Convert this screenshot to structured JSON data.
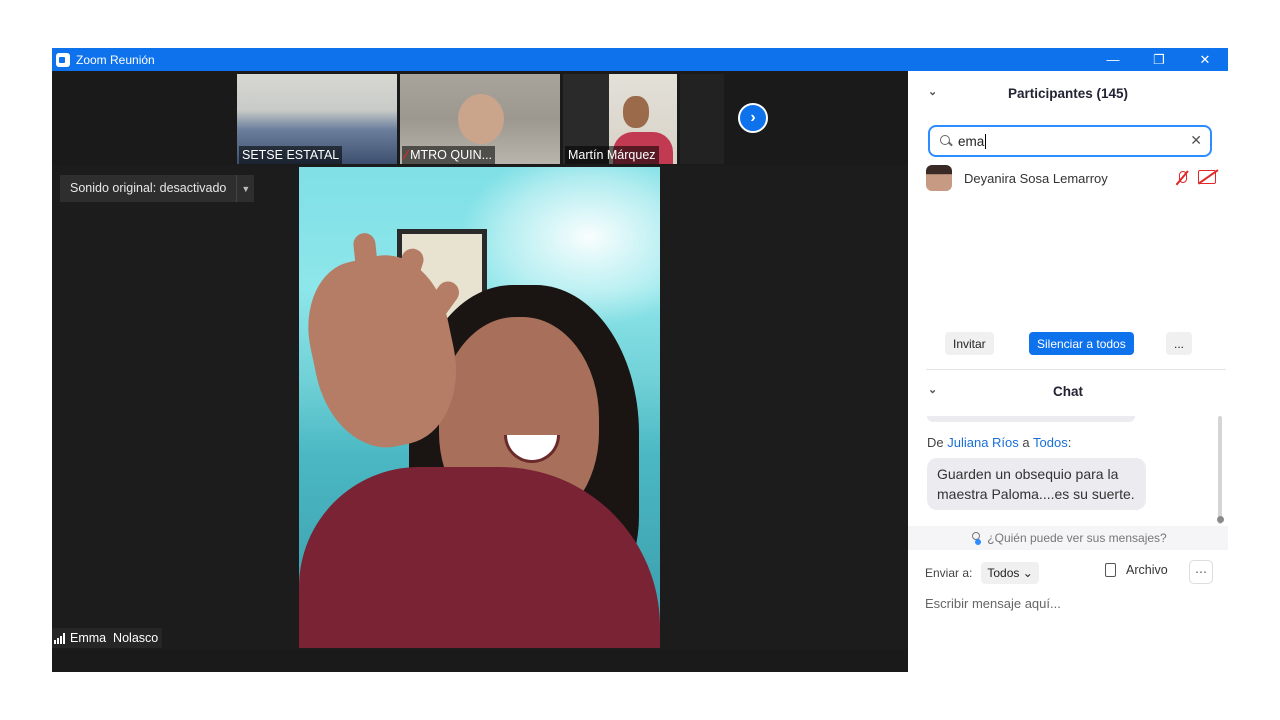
{
  "window": {
    "title": "Zoom Reunión",
    "controls": {
      "minimize": "—",
      "restore": "❐",
      "close": "✕"
    }
  },
  "thumbnails": [
    {
      "name": "SETSE ESTATAL",
      "muted": false
    },
    {
      "name": "MTRO QUIN...",
      "muted": true
    },
    {
      "name": "Martín Márquez",
      "muted": false
    }
  ],
  "video": {
    "sound_toggle_label": "Sonido original: desactivado",
    "speaker_name": "Emma  Nolasco",
    "next_icon": "chevron-right-icon"
  },
  "participants": {
    "header": "Participantes (145)",
    "search_value": "ema",
    "results": [
      {
        "name": "Deyanira Sosa Lemarroy",
        "mic": "muted",
        "video": "off"
      }
    ],
    "buttons": {
      "invite": "Invitar",
      "mute_all": "Silenciar a todos",
      "more": "..."
    }
  },
  "chat": {
    "header": "Chat",
    "last_message": {
      "prefix": "De ",
      "sender": "Juliana Ríos",
      "middle": " a ",
      "recipient": "Todos",
      "suffix": ":",
      "text": "Guarden un obsequio para la maestra Paloma....es su suerte."
    },
    "who_can_see": "¿Quién puede ver sus mensajes?",
    "send_to_label": "Enviar a:",
    "send_to_value": "Todos",
    "file_label": "Archivo",
    "input_placeholder": "Escribir mensaje aquí..."
  },
  "colors": {
    "brand_blue": "#0e72ed",
    "muted_red": "#e02828",
    "link_blue": "#1a6fd6"
  }
}
